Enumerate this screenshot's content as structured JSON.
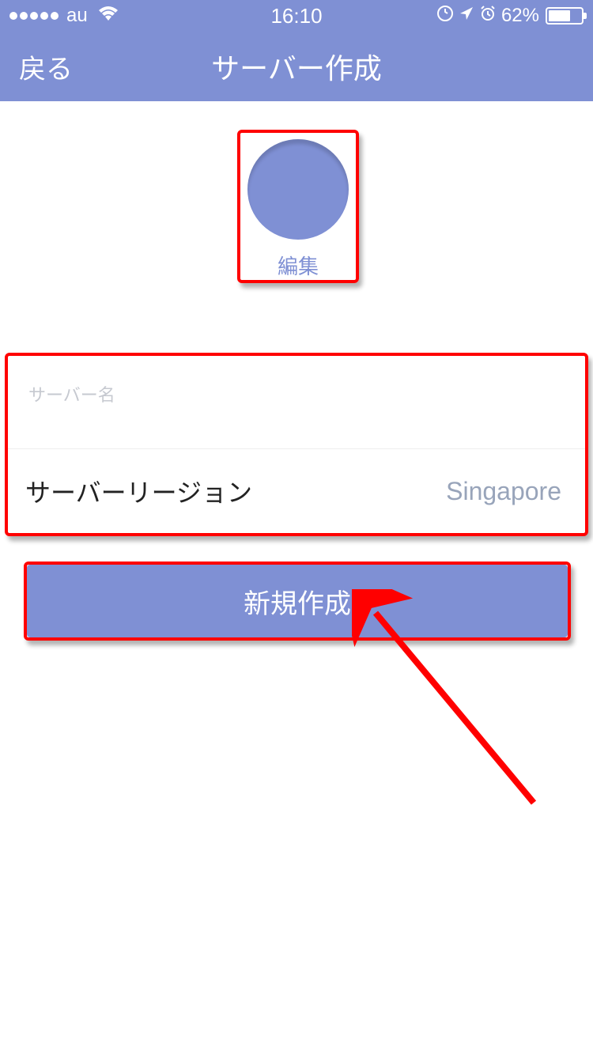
{
  "statusBar": {
    "carrier": "au",
    "time": "16:10",
    "batteryPercent": "62%"
  },
  "navBar": {
    "backLabel": "戻る",
    "title": "サーバー作成"
  },
  "avatar": {
    "editLabel": "編集"
  },
  "form": {
    "serverNamePlaceholder": "サーバー名",
    "serverNameValue": "",
    "regionLabel": "サーバーリージョン",
    "regionValue": "Singapore"
  },
  "createButton": {
    "label": "新規作成"
  },
  "colors": {
    "accent": "#7f90d4",
    "highlight": "#ff0000"
  }
}
